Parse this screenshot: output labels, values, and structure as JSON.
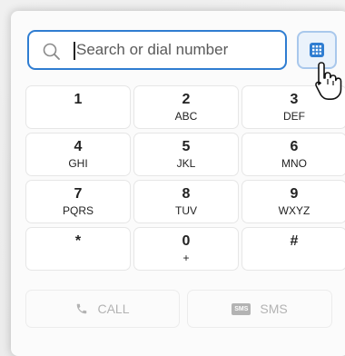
{
  "search": {
    "placeholder": "Search or dial number"
  },
  "keys": [
    {
      "digit": "1",
      "letters": ""
    },
    {
      "digit": "2",
      "letters": "ABC"
    },
    {
      "digit": "3",
      "letters": "DEF"
    },
    {
      "digit": "4",
      "letters": "GHI"
    },
    {
      "digit": "5",
      "letters": "JKL"
    },
    {
      "digit": "6",
      "letters": "MNO"
    },
    {
      "digit": "7",
      "letters": "PQRS"
    },
    {
      "digit": "8",
      "letters": "TUV"
    },
    {
      "digit": "9",
      "letters": "WXYZ"
    },
    {
      "digit": "*",
      "letters": ""
    },
    {
      "digit": "0",
      "letters": "+"
    },
    {
      "digit": "#",
      "letters": ""
    }
  ],
  "actions": {
    "call_label": "CALL",
    "sms_label": "SMS",
    "sms_badge": "SMS"
  },
  "colors": {
    "accent": "#2f7dd1",
    "keypad_button_bg": "#eaf2fb",
    "disabled_text": "#b3b3b3"
  }
}
